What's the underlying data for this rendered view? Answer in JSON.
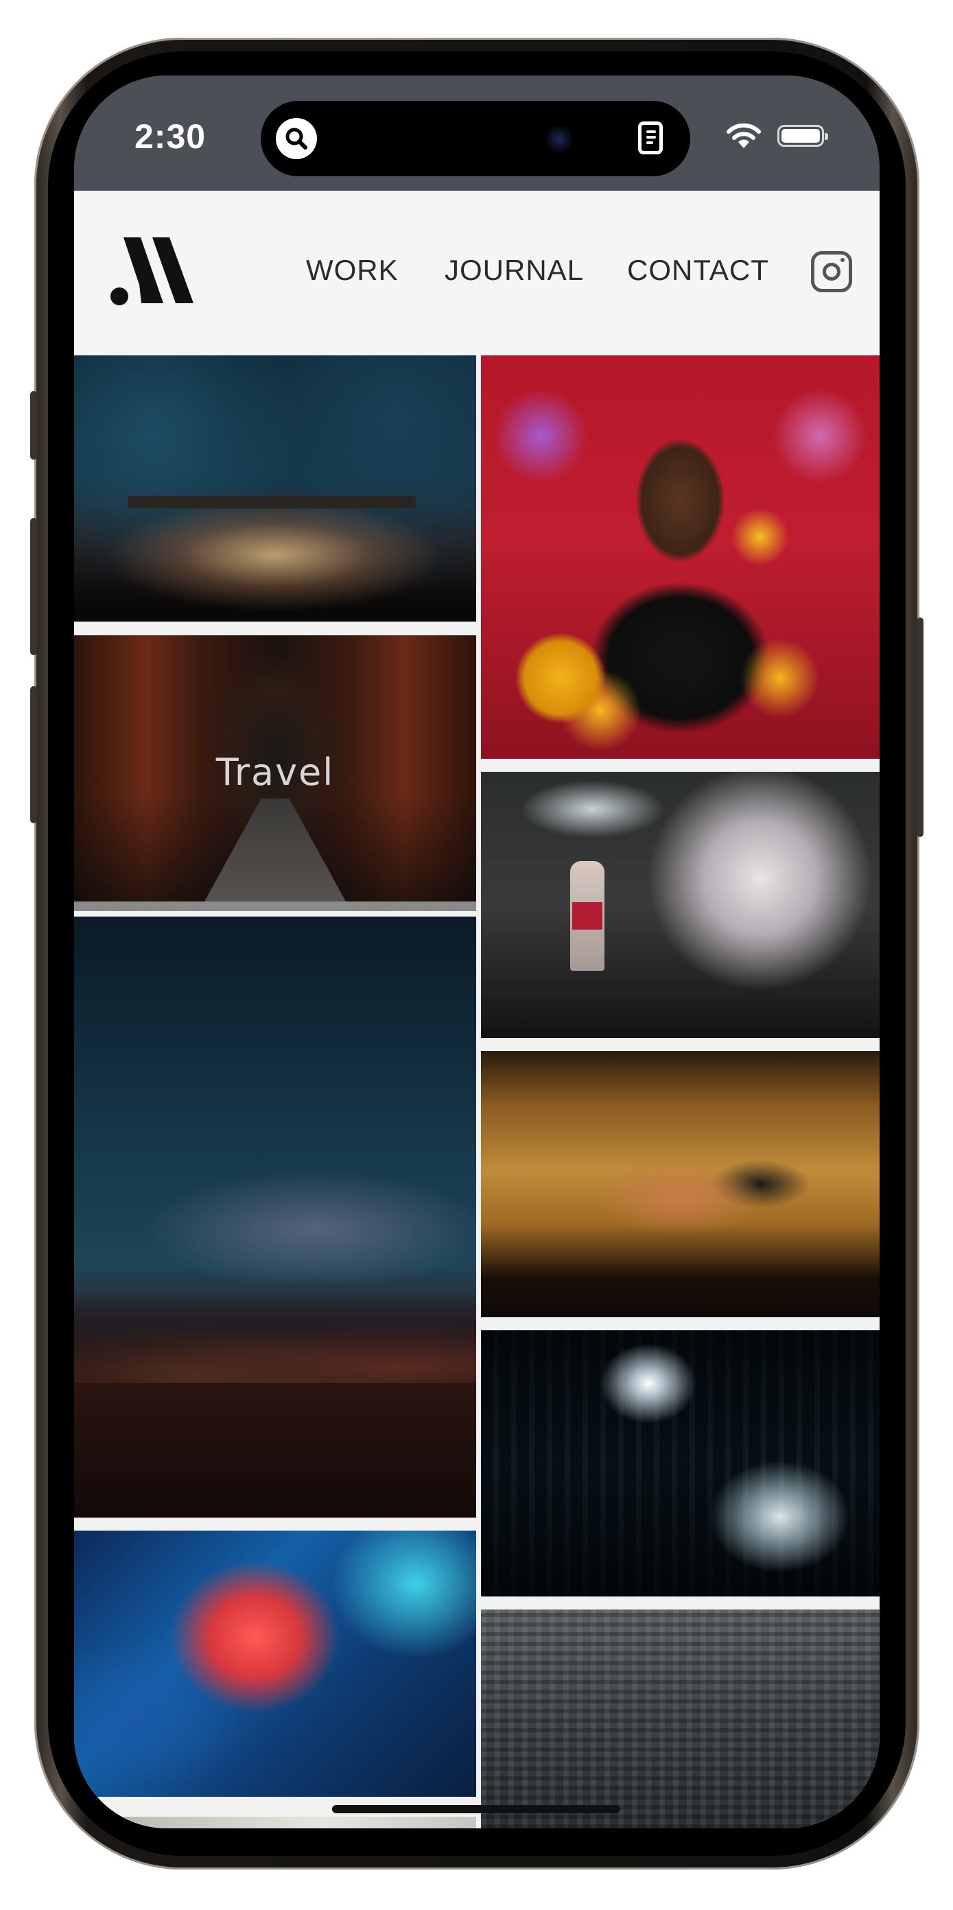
{
  "status_bar": {
    "time": "2:30",
    "icons": [
      "search-icon",
      "document-icon",
      "wifi-icon",
      "battery-icon"
    ]
  },
  "header": {
    "logo": "monogram-logo",
    "nav": [
      {
        "label": "WORK"
      },
      {
        "label": "JOURNAL"
      },
      {
        "label": "CONTACT"
      }
    ],
    "social_icon": "instagram-icon"
  },
  "gallery": {
    "tiles": [
      {
        "name": "tile-concert",
        "label": ""
      },
      {
        "name": "tile-sunflowers-portrait",
        "label": ""
      },
      {
        "name": "tile-torii-gates",
        "label": "Travel"
      },
      {
        "name": "tile-cherry-blossom",
        "label": ""
      },
      {
        "name": "tile-milky-way",
        "label": ""
      },
      {
        "name": "tile-sushi",
        "label": ""
      },
      {
        "name": "tile-city-night",
        "label": ""
      },
      {
        "name": "tile-abstract-light",
        "label": ""
      },
      {
        "name": "tile-cityscape-aerial",
        "label": ""
      },
      {
        "name": "tile-partial",
        "label": ""
      }
    ]
  },
  "colors": {
    "status_bar": "#4a5056",
    "header_bg": "#f5f5f5",
    "nav_text": "#2b2b2b",
    "grid_gap": "#f2f2f2"
  }
}
